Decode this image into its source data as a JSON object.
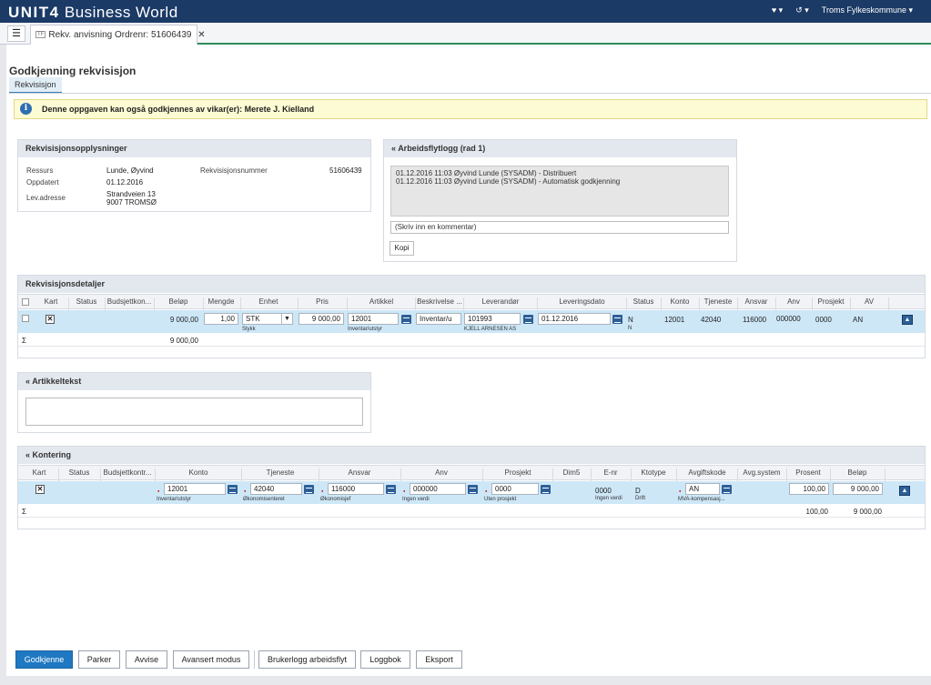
{
  "app": {
    "logo_brand": "UNIT4",
    "logo_product": "Business World",
    "company": "Troms Fylkeskommune"
  },
  "tab": {
    "tag": "TF",
    "title": "Rekv. anvisning Ordrenr: 51606439"
  },
  "page": {
    "title": "Godkjenning rekvisisjon",
    "subtab": "Rekvisisjon",
    "info": "Denne oppgaven kan også godkjennes av vikar(er): Merete J. Kielland"
  },
  "rekvinfo": {
    "title": "Rekvisisjonsopplysninger",
    "ressurs_label": "Ressurs",
    "ressurs_value": "Lunde, Øyvind",
    "rekvnr_label": "Rekvisisjonsnummer",
    "rekvnr_value": "51606439",
    "oppdatert_label": "Oppdatert",
    "oppdatert_value": "01.12.2016",
    "levadr_label": "Lev.adresse",
    "levadr_line1": "Strandveien 13",
    "levadr_line2": "9007 TROMSØ"
  },
  "workflow": {
    "title": "Arbeidsflytlogg (rad 1)",
    "log1": "01.12.2016 11:03 Øyvind Lunde (SYSADM) - Distribuert",
    "log2": "01.12.2016 11:03 Øyvind Lunde (SYSADM) - Automatisk godkjenning",
    "comment_placeholder": "(Skriv inn en kommentar)",
    "copy_button": "Kopi"
  },
  "details": {
    "title": "Rekvisisjonsdetaljer",
    "headers": [
      "Kart",
      "Status",
      "Budsjettkon...",
      "Beløp",
      "Mengde",
      "Enhet",
      "Pris",
      "Artikkel",
      "Beskrivelse ...",
      "Leverandør",
      "Leveringsdato",
      "Status",
      "Konto",
      "Tjeneste",
      "Ansvar",
      "Anv",
      "Prosjekt",
      "AV"
    ],
    "row": {
      "belop": "9 000,00",
      "mengde": "1,00",
      "enhet": "STK",
      "enhet_sub": "Stykk",
      "pris": "9 000,00",
      "artikkel": "12001",
      "artikkel_sub": "Inventar/utstyr",
      "beskrivelse": "Inventar/u",
      "leverandor": "101993",
      "leverandor_sub": "KJELL ARNESEN AS",
      "leveringsdato": "01.12.2016",
      "status": "N",
      "status_sub": "N",
      "konto": "12001",
      "tjeneste": "42040",
      "ansvar": "116000",
      "anv": "000000",
      "prosjekt": "0000",
      "av": "AN"
    },
    "sum_symbol": "Σ",
    "sum_belop": "9 000,00"
  },
  "artikkeltekst": {
    "title": "Artikkeltekst"
  },
  "kontering": {
    "title": "Kontering",
    "headers": [
      "Kart",
      "Status",
      "Budsjettkontr...",
      "Konto",
      "Tjeneste",
      "Ansvar",
      "Anv",
      "Prosjekt",
      "Dim5",
      "E-nr",
      "Ktotype",
      "Avgiftskode",
      "Avg.system",
      "Prosent",
      "Beløp"
    ],
    "row": {
      "konto": "12001",
      "konto_sub": "Inventar/utstyr",
      "tjeneste": "42040",
      "tjeneste_sub": "Økonomisenteret",
      "ansvar": "116000",
      "ansvar_sub": "Økonomisjef",
      "anv": "000000",
      "anv_sub": "Ingen verdi",
      "prosjekt": "0000",
      "prosjekt_sub": "Uten prosjekt",
      "enr": "0000",
      "enr_sub": "Ingen verdi",
      "ktotype": "D",
      "ktotype_sub": "Drift",
      "avgiftskode": "AN",
      "avgiftskode_sub": "MVA-kompensasj...",
      "prosent": "100,00",
      "belop": "9 000,00"
    },
    "sum_symbol": "Σ",
    "sum_prosent": "100,00",
    "sum_belop": "9 000,00"
  },
  "buttons": {
    "approve": "Godkjenne",
    "park": "Parker",
    "reject": "Avvise",
    "advanced": "Avansert modus",
    "userlog": "Brukerlogg arbeidsflyt",
    "logbook": "Loggbok",
    "export": "Eksport"
  },
  "icons": {
    "favorites": "heart-icon",
    "history": "history-icon",
    "menu": "list-icon",
    "info": "info-icon",
    "collapse": "chevron-up-double-icon",
    "lookup": "lookup-icon",
    "calendar": "calendar-icon",
    "map": "map-icon",
    "move_up": "arrow-up-icon"
  },
  "colors": {
    "header_bg": "#1b3a66",
    "primary_button": "#1f78c1",
    "selected_row": "#cde7f7",
    "info_bg": "#fdfbd3"
  }
}
